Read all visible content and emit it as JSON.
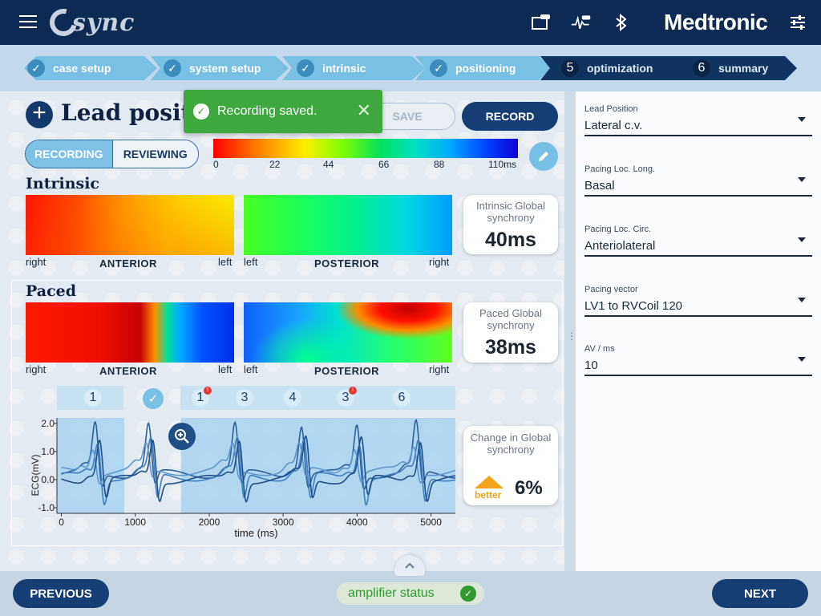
{
  "header": {
    "app_name": "sync",
    "brand": "Medtronic",
    "icons": [
      "menu-icon",
      "device-icon",
      "ecg-monitor-icon",
      "bluetooth-icon",
      "settings-sliders-icon"
    ]
  },
  "stepper": {
    "steps": [
      {
        "label": "case setup",
        "state": "done"
      },
      {
        "label": "system setup",
        "state": "done"
      },
      {
        "label": "intrinsic",
        "state": "done"
      },
      {
        "label": "positioning",
        "state": "done"
      },
      {
        "label": "optimization",
        "number": "5",
        "state": "todo"
      },
      {
        "label": "summary",
        "number": "6",
        "state": "todo"
      }
    ]
  },
  "page": {
    "title": "Lead positioning",
    "add_label": "+",
    "save_label": "SAVE",
    "record_label": "RECORD",
    "mode_recording": "RECORDING",
    "mode_reviewing": "REVIEWING"
  },
  "toast": {
    "message": "Recording saved.",
    "close": "✕"
  },
  "colorbar": {
    "ticks": [
      "0",
      "22",
      "44",
      "66",
      "88",
      "110ms"
    ]
  },
  "intrinsic": {
    "label": "Intrinsic",
    "anterior": {
      "name": "ANTERIOR",
      "left_label": "right",
      "right_label": "left"
    },
    "posterior": {
      "name": "POSTERIOR",
      "left_label": "left",
      "right_label": "right"
    },
    "metric_title": "Intrinsic Global synchrony",
    "metric_value": "40ms"
  },
  "paced": {
    "label": "Paced",
    "anterior": {
      "name": "ANTERIOR",
      "left_label": "right",
      "right_label": "left"
    },
    "posterior": {
      "name": "POSTERIOR",
      "left_label": "left",
      "right_label": "right"
    },
    "metric_title": "Paced Global synchrony",
    "metric_value": "38ms"
  },
  "beats": {
    "items": [
      "1",
      "1",
      "3",
      "4",
      "3",
      "6"
    ]
  },
  "change": {
    "title": "Change in Global synchrony",
    "trend_label": "better",
    "value": "6%"
  },
  "chart_data": {
    "type": "line",
    "xlabel": "time (ms)",
    "ylabel": "ECG(mV)",
    "xlim": [
      -60,
      5330
    ],
    "ylim": [
      -1.2,
      2.2
    ],
    "x_ticks": [
      0,
      1000,
      2000,
      3000,
      4000,
      5000
    ],
    "y_ticks": [
      2.0,
      1.0,
      0.0,
      -1.0
    ],
    "x_tick_labels": [
      "0",
      "1000",
      "2000",
      "3000",
      "4000",
      "5000"
    ],
    "y_tick_labels": [
      "2.0",
      "1.0",
      "0.0",
      "-1.0"
    ],
    "highlight_ranges": [
      [
        -60,
        850
      ],
      [
        1620,
        5330
      ]
    ],
    "beat_times": [
      460,
      1180,
      2350,
      3250,
      4000,
      4800
    ],
    "series": [
      {
        "color": "#2c5f9e"
      },
      {
        "color": "#3f7fbf"
      },
      {
        "color": "#5c98cf"
      },
      {
        "color": "#1f4f8a"
      }
    ]
  },
  "right_panel": {
    "fields": [
      {
        "label": "Lead Position",
        "value": "Lateral c.v."
      },
      {
        "label": "Pacing Loc. Long.",
        "value": "Basal"
      },
      {
        "label": "Pacing Loc. Circ.",
        "value": "Anteriolateral"
      },
      {
        "label": "Pacing vector",
        "value": "LV1 to RVCoil 120"
      },
      {
        "label": "AV / ms",
        "value": "10"
      }
    ]
  },
  "footer": {
    "previous": "PREVIOUS",
    "next": "NEXT",
    "amplifier": "amplifier status"
  }
}
